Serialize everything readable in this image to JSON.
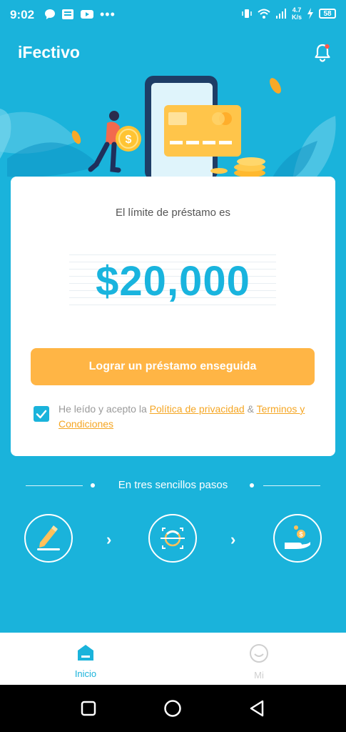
{
  "status_bar": {
    "time": "9:02",
    "network_speed_value": "4.7",
    "network_speed_unit": "K/s",
    "battery": "58"
  },
  "app": {
    "title": "iFectivo"
  },
  "card": {
    "limit_label": "El límite de préstamo es",
    "amount": "$20,000",
    "cta_label": "Lograr un préstamo enseguida",
    "consent_prefix": "He leído y acepto la",
    "privacy_link": "Política de privacidad",
    "ampersand": "&",
    "terms_link": "Terminos y Condiciones",
    "consent_checked": true
  },
  "steps": {
    "title": "En tres sencillos pasos",
    "icons": [
      "pen-icon",
      "face-scan-icon",
      "hand-coin-icon"
    ]
  },
  "bottom_nav": {
    "items": [
      {
        "label": "Inicio",
        "icon": "home-icon",
        "active": true
      },
      {
        "label": "Mi",
        "icon": "smiley-icon",
        "active": false
      }
    ]
  },
  "colors": {
    "primary": "#1ab3db",
    "accent": "#ffb545",
    "link": "#f5a623",
    "amount": "#19b4de",
    "nav_inactive": "#cfcfcf"
  }
}
